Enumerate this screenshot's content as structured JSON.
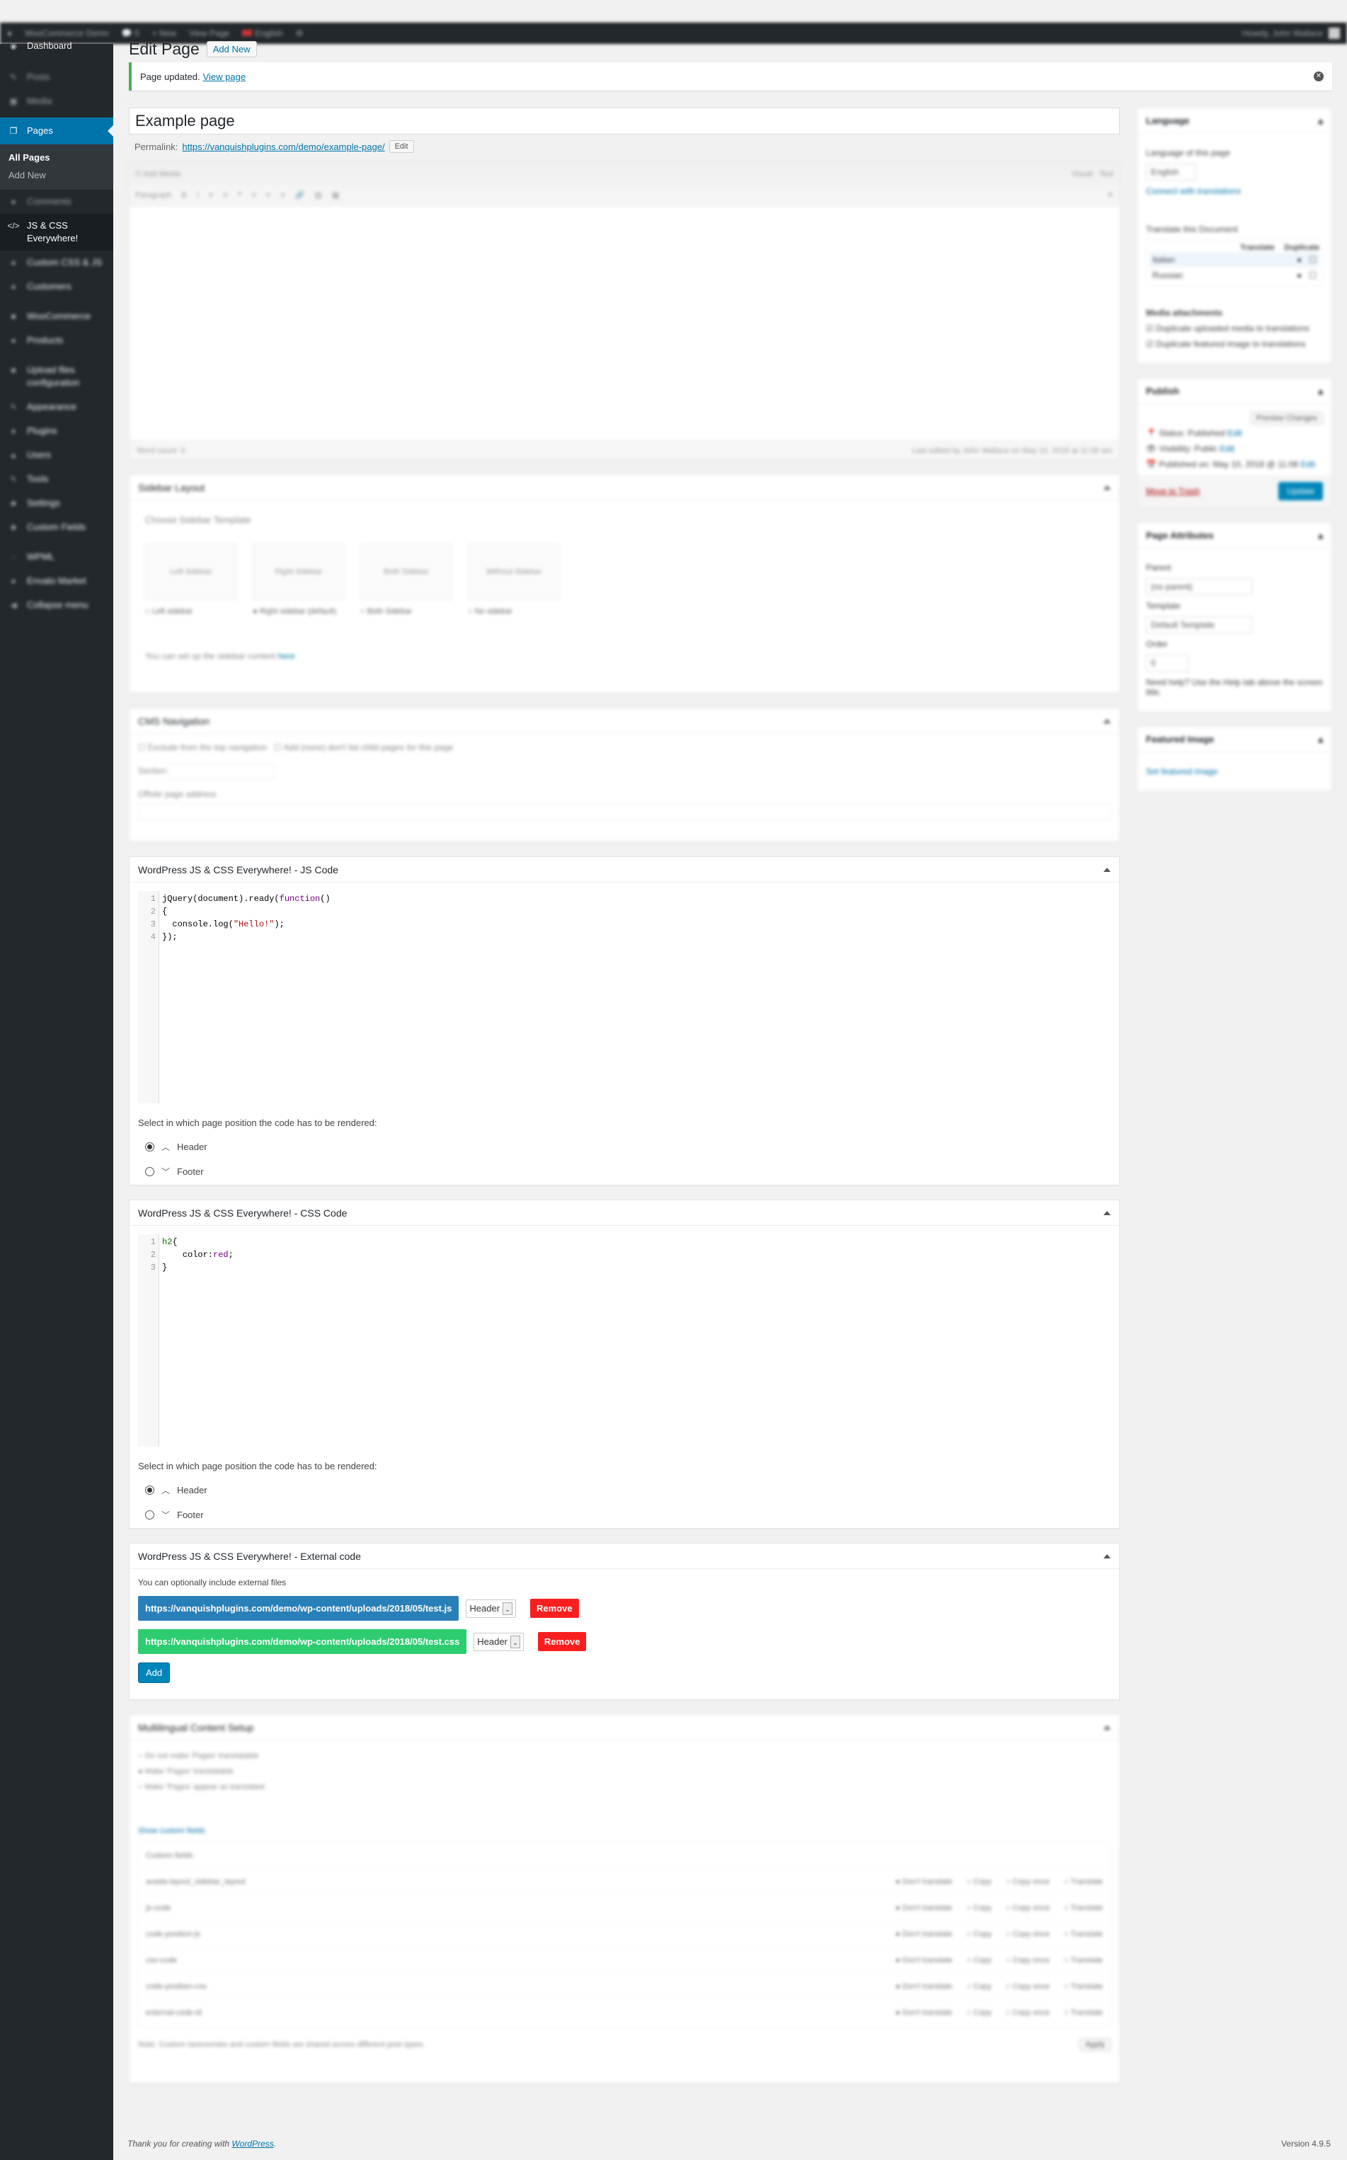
{
  "admin_bar": {
    "site_name": "WooCommerce Demo",
    "comments_count": "0",
    "new_label": "New",
    "view_page_label": "View Page",
    "language_label": "English",
    "howdy": "Howdy, John Wallace"
  },
  "sidebar": {
    "dashboard": "Dashboard",
    "posts": "Posts",
    "media": "Media",
    "pages": "Pages",
    "pages_submenu": [
      "All Pages",
      "Add New"
    ],
    "comments": "Comments",
    "js_css": "JS & CSS Everywhere!",
    "items_below": [
      "Custom CSS & JS",
      "Customers",
      "WooCommerce",
      "Products",
      "Upload files configuration",
      "Appearance",
      "Plugins",
      "Users",
      "Tools",
      "Settings",
      "Custom Fields",
      "WPML",
      "Envato Market",
      "Collapse menu"
    ]
  },
  "header": {
    "title": "Edit Page",
    "add_new": "Add New"
  },
  "notice": {
    "text": "Page updated.",
    "link": "View page"
  },
  "post": {
    "title": "Example page",
    "permalink_label": "Permalink:",
    "permalink_url": "https://vanquishplugins.com/demo/example-page/",
    "permalink_edit": "Edit"
  },
  "editor": {
    "add_media": "Add Media",
    "tab_visual": "Visual",
    "tab_text": "Text",
    "format_select": "Paragraph",
    "word_count": "Word count: 0",
    "last_edited": "Last edited by John Wallace on May 10, 2018 at 11:08 am"
  },
  "sidebar_layout": {
    "title": "Sidebar Layout",
    "choose": "Choose Sidebar Template",
    "options": [
      {
        "thumb": "Left Sidebar",
        "label": "Left sidebar",
        "checked": false
      },
      {
        "thumb": "Right Sidebar",
        "label": "Right sidebar (default)",
        "checked": true
      },
      {
        "thumb": "Both Sidebar",
        "label": "Both Sidebar",
        "checked": false
      },
      {
        "thumb": "Without Sidebar",
        "label": "No sidebar",
        "checked": false
      }
    ],
    "note": "You can set up the sidebar content",
    "note_link": "here"
  },
  "cms_nav": {
    "title": "CMS Navigation",
    "exclude": "Exclude from the top navigation",
    "hide_kids": "Add (none) don't list child pages for this page",
    "section_label": "Section",
    "offsite_label": "Offsite page address"
  },
  "js_code": {
    "title": "WordPress JS & CSS Everywhere! - JS Code",
    "line_numbers": [
      "1",
      "2",
      "3",
      "4"
    ],
    "lines": [
      [
        {
          "t": "jQuery(document).ready(",
          "c": ""
        },
        {
          "t": "function",
          "c": "kw"
        },
        {
          "t": "()",
          "c": ""
        }
      ],
      [
        {
          "t": "{",
          "c": ""
        }
      ],
      [
        {
          "t": "  console.log(",
          "c": ""
        },
        {
          "t": "\"Hello!\"",
          "c": "str"
        },
        {
          "t": ");",
          "c": ""
        }
      ],
      [
        {
          "t": "});",
          "c": ""
        }
      ]
    ],
    "position_label": "Select in which page position the code has to be rendered:",
    "positions": [
      {
        "label": "Header",
        "checked": true,
        "icon": "^"
      },
      {
        "label": "Footer",
        "checked": false,
        "icon": "v"
      }
    ]
  },
  "css_code": {
    "title": "WordPress JS & CSS Everywhere! - CSS Code",
    "line_numbers": [
      "1",
      "2",
      "3"
    ],
    "lines": [
      [
        {
          "t": "h2",
          "c": "tag"
        },
        {
          "t": "{",
          "c": ""
        }
      ],
      [
        {
          "t": "    color:",
          "c": ""
        },
        {
          "t": "red",
          "c": "val"
        },
        {
          "t": ";",
          "c": ""
        }
      ],
      [
        {
          "t": "}",
          "c": ""
        }
      ]
    ],
    "position_label": "Select in which page position the code has to be rendered:",
    "positions": [
      {
        "label": "Header",
        "checked": true,
        "icon": "^"
      },
      {
        "label": "Footer",
        "checked": false,
        "icon": "v"
      }
    ]
  },
  "external": {
    "title": "WordPress JS & CSS Everywhere! - External code",
    "intro": "You can optionally include external files",
    "files": [
      {
        "url": "https://vanquishplugins.com/demo/wp-content/uploads/2018/05/test.js",
        "position": "Header",
        "remove": "Remove",
        "color": "#2980b9"
      },
      {
        "url": "https://vanquishplugins.com/demo/wp-content/uploads/2018/05/test.css",
        "position": "Header",
        "remove": "Remove",
        "color": "#2ecc71"
      }
    ],
    "add": "Add"
  },
  "multilingual": {
    "title": "Multilingual Content Setup",
    "options": [
      {
        "label": "Do not make 'Pages' translatable",
        "checked": false
      },
      {
        "label": "Make 'Pages' translatable",
        "checked": true
      },
      {
        "label": "Make 'Pages' appear as translated",
        "checked": false
      }
    ],
    "show_fields": "Show custom fields",
    "table_header": "Custom fields",
    "rows": [
      "avada-layout_sidebar_layout",
      "js-code",
      "code-position-js",
      "css-code",
      "code-position-css",
      "external-code-id"
    ],
    "row_options": [
      "Don't translate",
      "Copy",
      "Copy once",
      "Translate"
    ],
    "note": "Note: Custom taxonomies and custom fields are shared across different post types.",
    "apply": "Apply"
  },
  "right": {
    "language": {
      "title": "Language",
      "label": "Language of this page",
      "value": "English",
      "connect": "Connect with translations",
      "translate_title": "Translate this Document",
      "cols": [
        "Translate",
        "Duplicate"
      ],
      "langs": [
        "Italian",
        "Russian"
      ],
      "media_title": "Media attachments",
      "media_opts": [
        "Duplicate uploaded media to translations",
        "Duplicate featured image to translations"
      ]
    },
    "publish": {
      "title": "Publish",
      "preview": "Preview Changes",
      "status": "Status: Published",
      "visibility": "Visibility: Public",
      "published": "Published on: May 10, 2018 @ 11:08",
      "edit": "Edit",
      "trash": "Move to Trash",
      "update": "Update"
    },
    "attributes": {
      "title": "Page Attributes",
      "parent_label": "Parent",
      "parent_value": "(no parent)",
      "template_label": "Template",
      "template_value": "Default Template",
      "order_label": "Order",
      "order_value": "0",
      "help": "Need help? Use the Help tab above the screen title."
    },
    "featured": {
      "title": "Featured Image",
      "link": "Set featured image"
    }
  },
  "footer": {
    "thanks": "Thank you for creating with",
    "wp_link": "WordPress",
    "version": "Version 4.9.5"
  }
}
